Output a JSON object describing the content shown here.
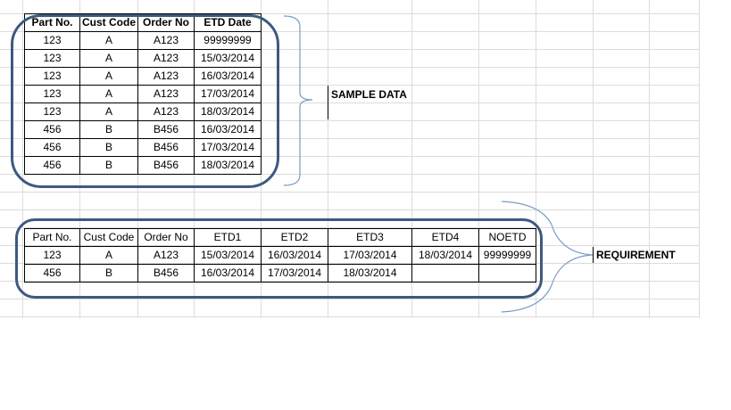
{
  "sample": {
    "label": "SAMPLE DATA",
    "headers": [
      "Part No.",
      "Cust Code",
      "Order No",
      "ETD Date"
    ],
    "rows": [
      [
        "123",
        "A",
        "A123",
        "99999999"
      ],
      [
        "123",
        "A",
        "A123",
        "15/03/2014"
      ],
      [
        "123",
        "A",
        "A123",
        "16/03/2014"
      ],
      [
        "123",
        "A",
        "A123",
        "17/03/2014"
      ],
      [
        "123",
        "A",
        "A123",
        "18/03/2014"
      ],
      [
        "456",
        "B",
        "B456",
        "16/03/2014"
      ],
      [
        "456",
        "B",
        "B456",
        "17/03/2014"
      ],
      [
        "456",
        "B",
        "B456",
        "18/03/2014"
      ]
    ]
  },
  "requirement": {
    "label": "REQUIREMENT",
    "headers": [
      "Part No.",
      "Cust Code",
      "Order No",
      "ETD1",
      "ETD2",
      "ETD3",
      "ETD4",
      "NOETD"
    ],
    "rows": [
      [
        "123",
        "A",
        "A123",
        "15/03/2014",
        "16/03/2014",
        "17/03/2014",
        "18/03/2014",
        "99999999"
      ],
      [
        "456",
        "B",
        "B456",
        "16/03/2014",
        "17/03/2014",
        "18/03/2014",
        "",
        ""
      ]
    ]
  },
  "colors": {
    "frame": "#3d5a80",
    "gridline": "#dcdcdc",
    "bracket": "#7a9cc6"
  }
}
